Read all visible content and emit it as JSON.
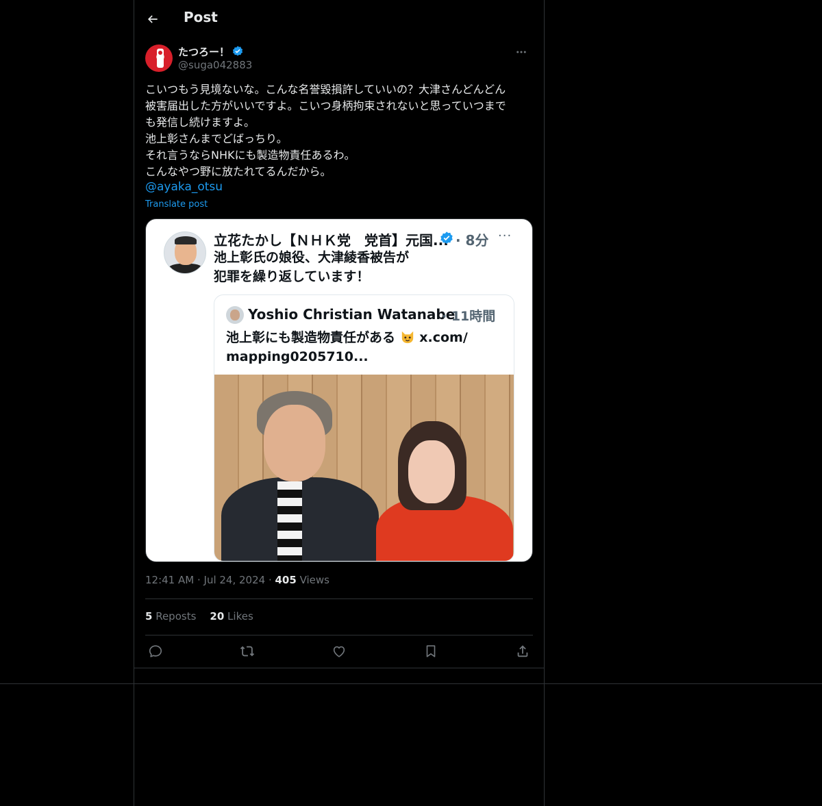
{
  "header": {
    "title": "Post",
    "back_icon": "arrow-left-icon"
  },
  "post": {
    "author": {
      "display_name": "たつろー！",
      "handle": "@suga042883",
      "verified": true,
      "verified_color": "#1d9bf0"
    },
    "text": "こいつもう見境ないな。こんな名誉毀損許していいの？大津さんどんどん\n被害届出した方がいいですよ。こいつ身柄拘束されないと思っていつまで\nも発信し続けますよ。\n池上彰さんまでどばっちり。\nそれ言うならNHKにも製造物責任あるわ。\nこんなやつ野に放たれてるんだから。",
    "mention": "@ayaka_otsu",
    "translate_label": "Translate post",
    "media": {
      "quoted_name": "立花たかし【ＮＨＫ党　党首】元国...",
      "quoted_time": "· 8分",
      "quoted_more": "···",
      "quoted_text": "池上彰氏の娘役、大津綾香被告が\n犯罪を繰り返しています！",
      "inner_name": "Yoshio Christian Watanabe",
      "inner_time": "· 11時間",
      "inner_text_1": "池上彰にも製造物責任がある",
      "inner_text_emoji": "cat-face-icon",
      "inner_text_2": " x.com/\nmapping0205710..."
    },
    "meta": {
      "time": "12:41 AM",
      "sep1": " · ",
      "date": "Jul 24, 2024",
      "sep2": " · ",
      "views_count": "405",
      "views_label": " Views"
    },
    "stats": {
      "reposts_count": "5",
      "reposts_label": " Reposts",
      "likes_count": "20",
      "likes_label": " Likes"
    },
    "actions": [
      "reply-icon",
      "repost-icon",
      "like-icon",
      "bookmark-icon",
      "share-icon"
    ]
  },
  "colors": {
    "background": "#000000",
    "text_primary": "#e7e9ea",
    "text_secondary": "#71767b",
    "accent": "#1d9bf0",
    "border": "#2f3336"
  }
}
